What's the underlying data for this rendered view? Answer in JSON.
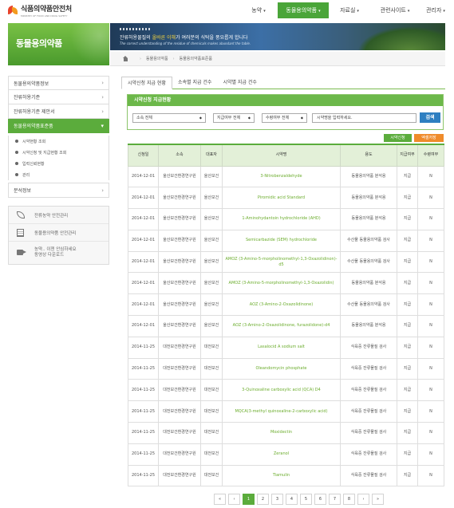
{
  "header": {
    "logo_title": "식품의약품안전처",
    "logo_sub": "MINISTRY OF FOOD AND DRUG SAFETY",
    "nav": [
      {
        "label": "농약",
        "active": false
      },
      {
        "label": "동물용의약품",
        "active": true
      },
      {
        "label": "자료실",
        "active": false
      },
      {
        "label": "관련사이트",
        "active": false
      },
      {
        "label": "관리자",
        "active": false
      }
    ]
  },
  "section_title": "동물용의약품",
  "visual": {
    "text_pre": "잔류허용물질의",
    "text_em": "올바른 이해",
    "text_post": "가 여러분의 식탁을 풍요롭게 합니다",
    "sub": "The correct understanding of the residue of chemicals makes abundant the table."
  },
  "breadcrumb": [
    "동물용의약품",
    "동물용의약품표준품"
  ],
  "sidebar": {
    "items": [
      {
        "label": "동물용의약품정보",
        "active": false
      },
      {
        "label": "잔류허용기준",
        "active": false
      },
      {
        "label": "잔류허용기준 제안서",
        "active": false
      },
      {
        "label": "동물용의약품표준품",
        "active": true
      }
    ],
    "subitems": [
      "시약현황 조회",
      "시약신청 및 지급현황 조회",
      "입력신뢰현황",
      "관리"
    ],
    "after": {
      "label": "분석정보"
    }
  },
  "quick_links": [
    {
      "label": "잔류농약 안전관리",
      "icon": "leaf-icon"
    },
    {
      "label": "동물용의약품 안전관리",
      "icon": "document-icon"
    },
    {
      "label_line1": "농약.. 이젠 안심하세요",
      "label_line2": "동영상 다운로드",
      "icon": "video-icon"
    }
  ],
  "tabs": [
    {
      "label": "시약신청 지급 현황",
      "active": true
    },
    {
      "label": "소속별 지급 건수",
      "active": false
    },
    {
      "label": "시약별 지급 건수",
      "active": false
    }
  ],
  "search": {
    "title": "시약신청 지급현황",
    "select_org": "소속 전체",
    "select_pay": "지급여부 전체",
    "select_ok": "수령여부 전체",
    "keyword_value": "시약명을 입력하세요.",
    "button": "검색"
  },
  "actions": {
    "request": "시약신청",
    "excel": "엑셀저장"
  },
  "table": {
    "headers": [
      "신청일",
      "소속",
      "대표자",
      "시약명",
      "용도",
      "지급여부",
      "수령여부"
    ],
    "rows": [
      [
        "2014-12-01",
        "울산보건환경연구원",
        "울산보건",
        "3-Nitrobenzaldehyde",
        "동물용의약품 분석용",
        "지급",
        "N"
      ],
      [
        "2014-12-01",
        "울산보건환경연구원",
        "울산보건",
        "Piromidic acid Standard",
        "동물용의약품 분석용",
        "지급",
        "N"
      ],
      [
        "2014-12-01",
        "울산보건환경연구원",
        "울산보건",
        "1-Aminohydantoin hydrochloride (AHD)",
        "동물용의약품 분석용",
        "지급",
        "N"
      ],
      [
        "2014-12-01",
        "울산보건환경연구원",
        "울산보건",
        "Semicarbazide (SEM) hydrochloride",
        "수산물 동물용의약품 검사",
        "지급",
        "N"
      ],
      [
        "2014-12-01",
        "울산보건환경연구원",
        "울산보건",
        "AMOZ (3-Amino-5-morpholinomethyl-1,3-Oxazolidinon)-d5",
        "수산물 동물용의약품 검사",
        "지급",
        "N"
      ],
      [
        "2014-12-01",
        "울산보건환경연구원",
        "울산보건",
        "AMOZ (3-Amino-5-morpholinomethyl-1,3-Oxazolidin)",
        "동물용의약품 분석용",
        "지급",
        "N"
      ],
      [
        "2014-12-01",
        "울산보건환경연구원",
        "울산보건",
        "AOZ (3-Amino-2-Oxazolidinone)",
        "수산물 동물용의약품 검사",
        "지급",
        "N"
      ],
      [
        "2014-12-01",
        "울산보건환경연구원",
        "울산보건",
        "AOZ (3-Amino-2-Oxazolidinone, furazolidone)-d4",
        "동물용의약품 분석용",
        "지급",
        "N"
      ],
      [
        "2014-11-25",
        "대전보건환경연구원",
        "대전보건",
        "Lasalocid A sodium salt",
        "식육중 잔류물질 검사",
        "지급",
        "N"
      ],
      [
        "2014-11-25",
        "대전보건환경연구원",
        "대전보건",
        "Oleandomycin phosphate",
        "식육중 잔류물질 검사",
        "지급",
        "N"
      ],
      [
        "2014-11-25",
        "대전보건환경연구원",
        "대전보건",
        "3-Quinoxaline carboxylic acid (QCA) D4",
        "식육중 잔류물질 검사",
        "지급",
        "N"
      ],
      [
        "2014-11-25",
        "대전보건환경연구원",
        "대전보건",
        "MQCA(3-methyl quinoxaline-2-carboxylic acid)",
        "식육중 잔류물질 검사",
        "지급",
        "N"
      ],
      [
        "2014-11-25",
        "대전보건환경연구원",
        "대전보건",
        "Moxidectin",
        "식육중 잔류물질 검사",
        "지급",
        "N"
      ],
      [
        "2014-11-25",
        "대전보건환경연구원",
        "대전보건",
        "Zeranol",
        "식육중 잔류물질 검사",
        "지급",
        "N"
      ],
      [
        "2014-11-25",
        "대전보건환경연구원",
        "대전보건",
        "Tiamulin",
        "식육중 잔류물질 검사",
        "지급",
        "N"
      ]
    ]
  },
  "pagination": {
    "first": "«",
    "prev": "‹",
    "next": "›",
    "last": "»",
    "pages": [
      "1",
      "2",
      "3",
      "4",
      "5",
      "6",
      "7",
      "8"
    ],
    "current": "1"
  },
  "colors": {
    "accent": "#5bac3c",
    "link": "#6cad2e",
    "search_button": "#2e7fc1",
    "excel": "#ef8b2b"
  }
}
